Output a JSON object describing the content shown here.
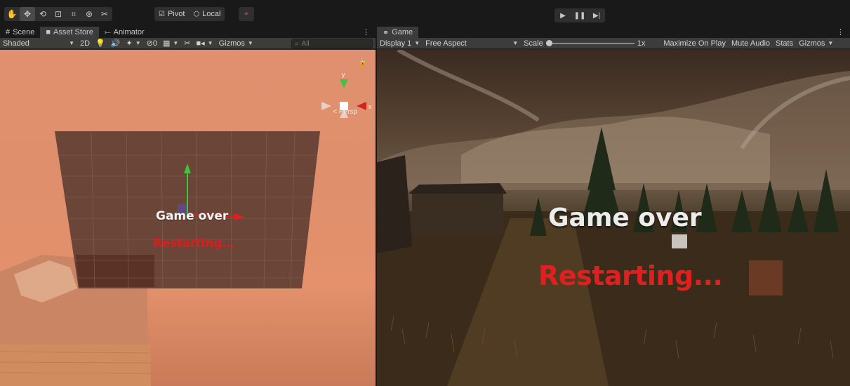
{
  "toolbar": {
    "tools": [
      {
        "icon": "hand-icon",
        "glyph": "✋"
      },
      {
        "icon": "move-icon",
        "glyph": "✥"
      },
      {
        "icon": "rotate-icon",
        "glyph": "⟲"
      },
      {
        "icon": "scale-icon",
        "glyph": "⊡"
      },
      {
        "icon": "rect-icon",
        "glyph": "⌗"
      },
      {
        "icon": "transform-icon",
        "glyph": "⊛"
      },
      {
        "icon": "custom-tool-icon",
        "glyph": "✂"
      }
    ],
    "pivot_label": "Pivot",
    "local_label": "Local",
    "snap_glyph": "⌖",
    "play_glyph": "▶",
    "pause_glyph": "❚❚",
    "step_glyph": "▶|"
  },
  "scene": {
    "tabs": [
      {
        "label": "Scene",
        "glyph": "#"
      },
      {
        "label": "Asset Store",
        "glyph": "■"
      },
      {
        "label": "Animator",
        "glyph": "⤚"
      }
    ],
    "menu_glyph": "⋮",
    "draw_mode": "Shaded",
    "toggle_2d": "2D",
    "hidden_count": "0",
    "gizmos_label": "Gizmos",
    "search_placeholder": "All",
    "persp_label": "Persp",
    "overlay_title": "Game over",
    "overlay_subtitle": "Restarting..."
  },
  "game": {
    "tab_label": "Game",
    "tab_glyph": "⚭",
    "menu_glyph": "⋮",
    "display": "Display 1",
    "aspect": "Free Aspect",
    "scale_label": "Scale",
    "scale_value": "1x",
    "maximize_label": "Maximize On Play",
    "mute_label": "Mute Audio",
    "stats_label": "Stats",
    "gizmos_label": "Gizmos",
    "title": "Game over",
    "subtitle": "Restarting..."
  },
  "colors": {
    "accent_red": "#d81f1f",
    "gizmo_green": "#3fc23f",
    "gizmo_red": "#e02020"
  }
}
